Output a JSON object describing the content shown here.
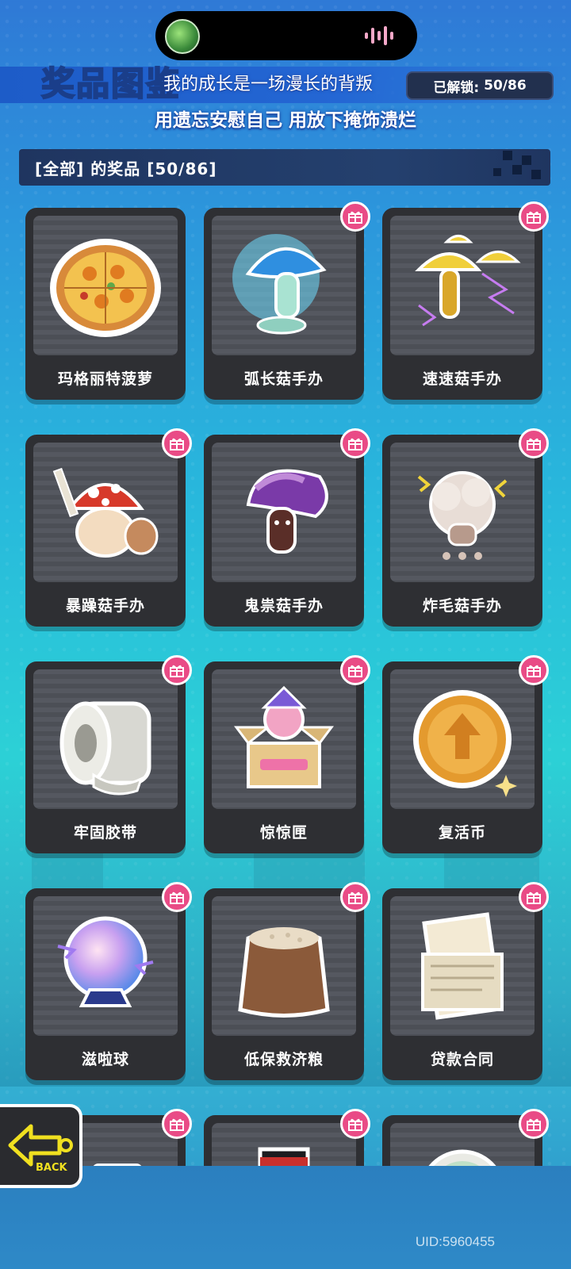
{
  "header": {
    "title_logo": "奖品图鉴",
    "lyric_line1": "我的成长是一场漫长的背叛",
    "lyric_line2": "用遗忘安慰自己 用放下掩饰溃烂",
    "unlock_label": "已解锁:",
    "unlock_count": "50/86"
  },
  "section": {
    "title": "[全部] 的奖品 [50/86]"
  },
  "items": [
    {
      "label": "玛格丽特菠萝",
      "icon": "pizza-icon",
      "gift": false
    },
    {
      "label": "弧长菇手办",
      "icon": "mushroom-figure-blue-icon",
      "gift": true
    },
    {
      "label": "速速菇手办",
      "icon": "mushroom-figure-yellow-icon",
      "gift": true
    },
    {
      "label": "暴躁菇手办",
      "icon": "mushroom-figure-red-icon",
      "gift": true
    },
    {
      "label": "鬼祟菇手办",
      "icon": "mushroom-figure-purple-icon",
      "gift": true
    },
    {
      "label": "炸毛菇手办",
      "icon": "mushroom-figure-fluffy-icon",
      "gift": true
    },
    {
      "label": "牢固胶带",
      "icon": "tape-roll-icon",
      "gift": true
    },
    {
      "label": "惊惊匣",
      "icon": "surprise-box-icon",
      "gift": true
    },
    {
      "label": "复活币",
      "icon": "revive-coin-icon",
      "gift": true
    },
    {
      "label": "滋啦球",
      "icon": "crystal-ball-icon",
      "gift": true
    },
    {
      "label": "低保救济粮",
      "icon": "grain-sack-icon",
      "gift": true
    },
    {
      "label": "贷款合同",
      "icon": "loan-contract-icon",
      "gift": true
    },
    {
      "label": "",
      "icon": "ticket-icon",
      "gift": true
    },
    {
      "label": "",
      "icon": "top-hat-icon",
      "gift": true
    },
    {
      "label": "",
      "icon": "jade-token-icon",
      "gift": true
    }
  ],
  "footer": {
    "back_label": "BACK",
    "uid": "UID:5960455"
  },
  "colors": {
    "accent_pink": "#e94b86",
    "card_bg": "#2e2f33",
    "title_green": "#b7f35a"
  }
}
